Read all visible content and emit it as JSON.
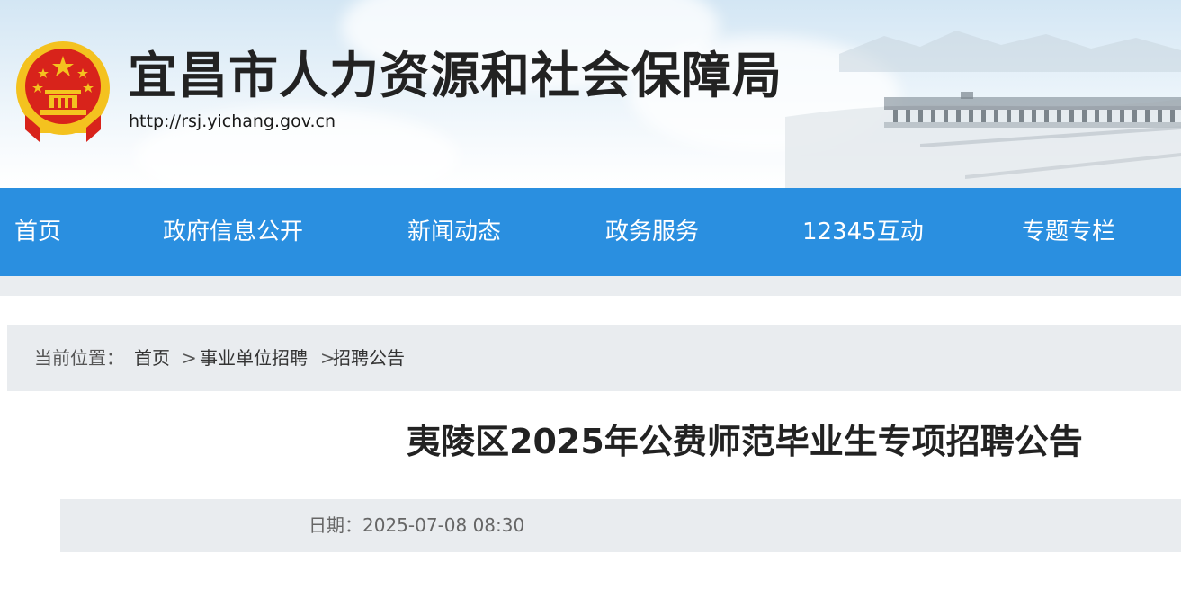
{
  "header": {
    "site_title": "宜昌市人力资源和社会保障局",
    "site_url": "http://rsj.yichang.gov.cn"
  },
  "nav": {
    "items": [
      {
        "label": "首页"
      },
      {
        "label": "政府信息公开"
      },
      {
        "label": "新闻动态"
      },
      {
        "label": "政务服务"
      },
      {
        "label": "12345互动"
      },
      {
        "label": "专题专栏"
      }
    ]
  },
  "breadcrumb": {
    "label": "当前位置：",
    "home": "首页",
    "sep1": ">",
    "category": "事业单位招聘",
    "sep2": ">",
    "subcategory": "招聘公告"
  },
  "article": {
    "title": "夷陵区2025年公费师范毕业生专项招聘公告",
    "date": "日期：2025-07-08 08:30"
  },
  "colors": {
    "nav_bg": "#2a8fe0",
    "emblem_red": "#d8231b",
    "emblem_gold": "#f4c21f"
  }
}
